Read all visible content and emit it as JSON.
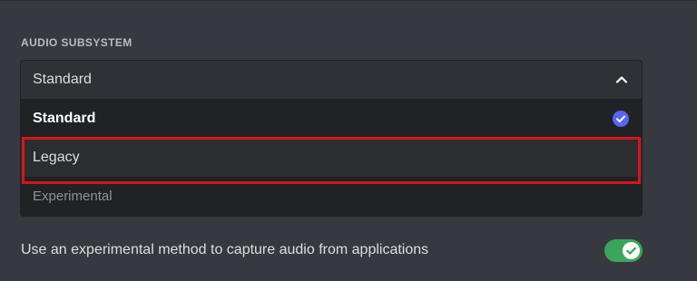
{
  "audio_subsystem": {
    "section_title": "AUDIO SUBSYSTEM",
    "selected_value": "Standard",
    "expanded": true,
    "options": [
      {
        "label": "Standard",
        "selected": true
      },
      {
        "label": "Legacy",
        "selected": false,
        "highlighted": true
      },
      {
        "label": "Experimental",
        "selected": false
      }
    ]
  },
  "experimental_capture": {
    "label": "Use an experimental method to capture audio from applications",
    "enabled": true
  },
  "colors": {
    "background": "#36393f",
    "dropdown_bg": "#202225",
    "accent_check": "#5865f2",
    "toggle_on": "#3ba55c",
    "highlight_box": "#d8141b"
  },
  "icons": {
    "dropdown_chevron": "chevron-up-icon",
    "selected_check": "check-circle-icon",
    "toggle_check": "check-icon"
  }
}
